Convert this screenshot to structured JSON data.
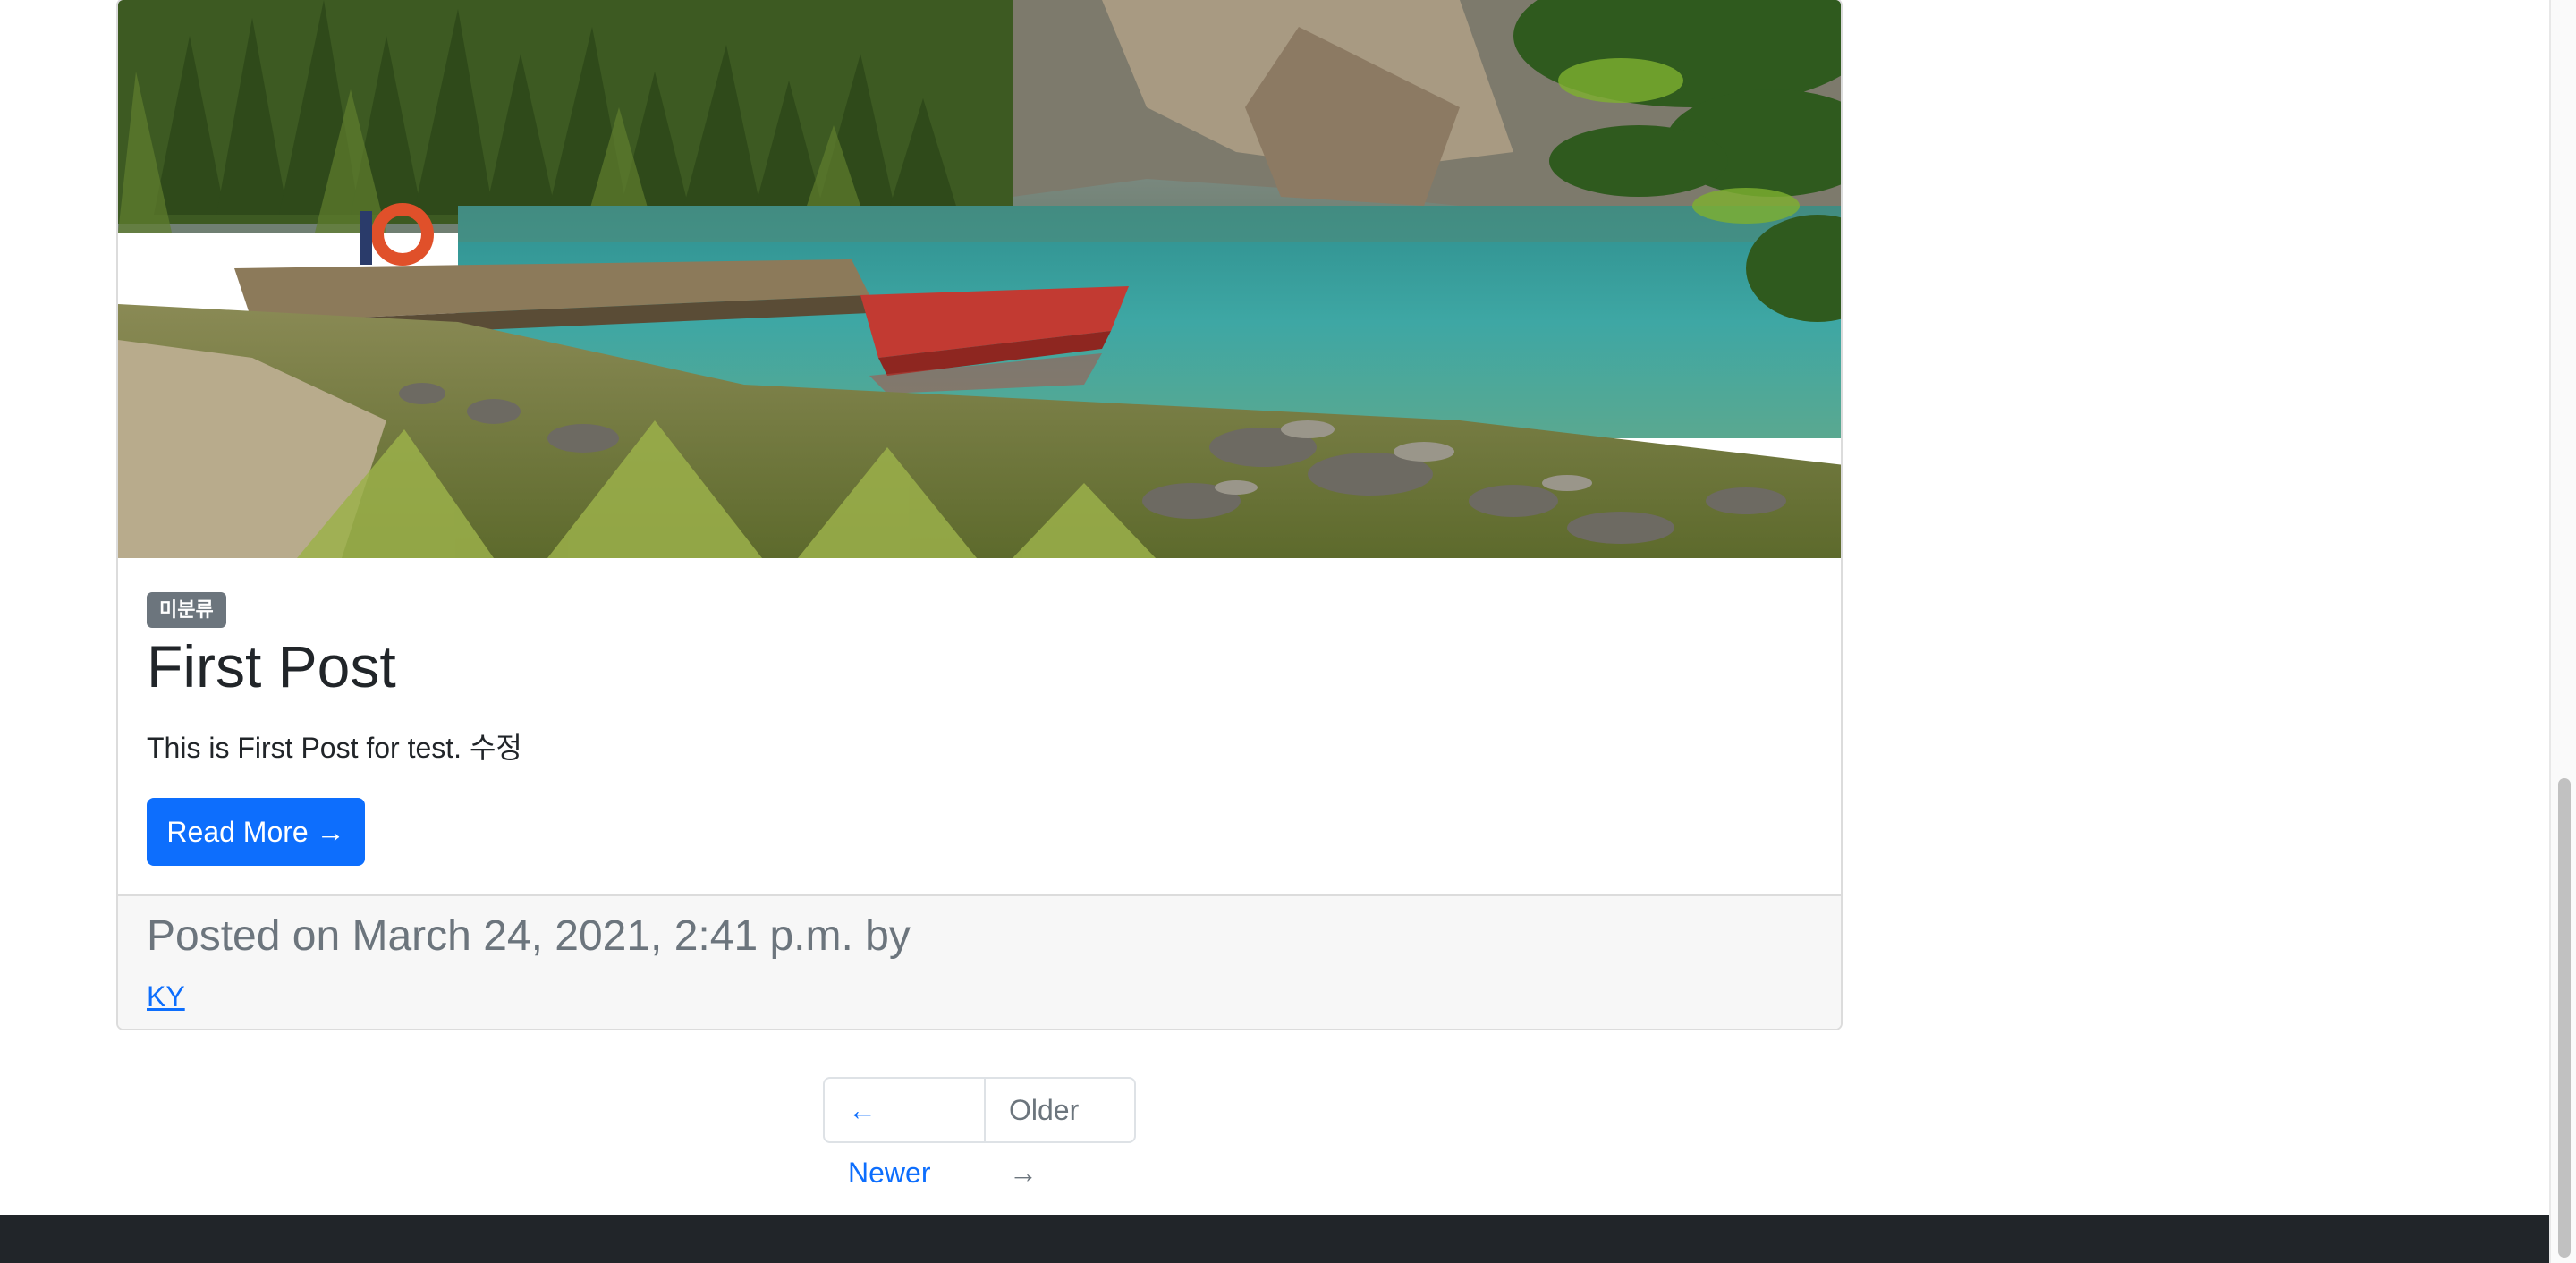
{
  "post": {
    "category_badge": "미분류",
    "title": "First Post",
    "excerpt": "This is First Post for test. 수정",
    "read_more_label": "Read More →",
    "posted_on": "Posted on March 24, 2021, 2:41 p.m. by",
    "author": "KY"
  },
  "pagination": {
    "newer_label": "← Newer",
    "older_label": "Older →"
  },
  "colors": {
    "primary": "#0d6efd",
    "secondary": "#6c757d",
    "footer_bg": "#212529",
    "card_footer_bg": "#f7f7f7"
  }
}
